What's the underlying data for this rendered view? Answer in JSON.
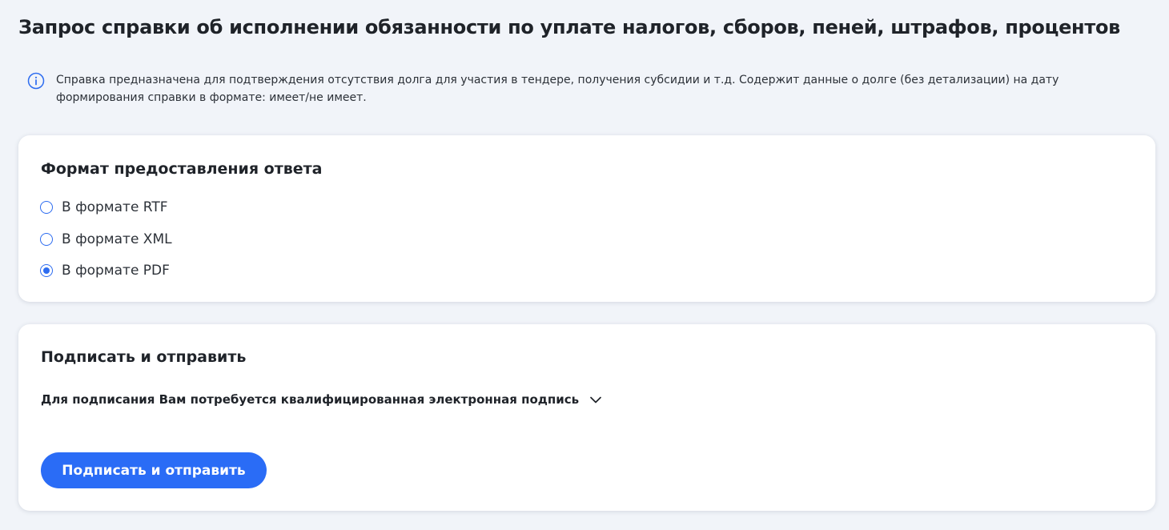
{
  "page": {
    "title": "Запрос справки об исполнении обязанности по уплате налогов, сборов, пеней, штрафов, процентов"
  },
  "info": {
    "icon": "info-icon",
    "text": "Справка предназначена для подтверждения отсутствия долга для участия в тендере, получения субсидии и т.д. Содержит данные о долге (без детализации) на дату формирования справки в формате: имеет/не имеет."
  },
  "format_section": {
    "title": "Формат предоставления ответа",
    "options": [
      {
        "label": "В формате RTF",
        "checked": false
      },
      {
        "label": "В формате XML",
        "checked": false
      },
      {
        "label": "В формате PDF",
        "checked": true
      }
    ]
  },
  "sign_section": {
    "title": "Подписать и отправить",
    "signature_note": "Для подписания Вам потребуется квалифицированная электронная подпись",
    "chevron_icon": "chevron-down-icon",
    "button_label": "Подписать и отправить"
  },
  "colors": {
    "accent": "#2a6cf6",
    "background": "#f1f4f9",
    "card": "#ffffff",
    "text": "#1f2329"
  }
}
